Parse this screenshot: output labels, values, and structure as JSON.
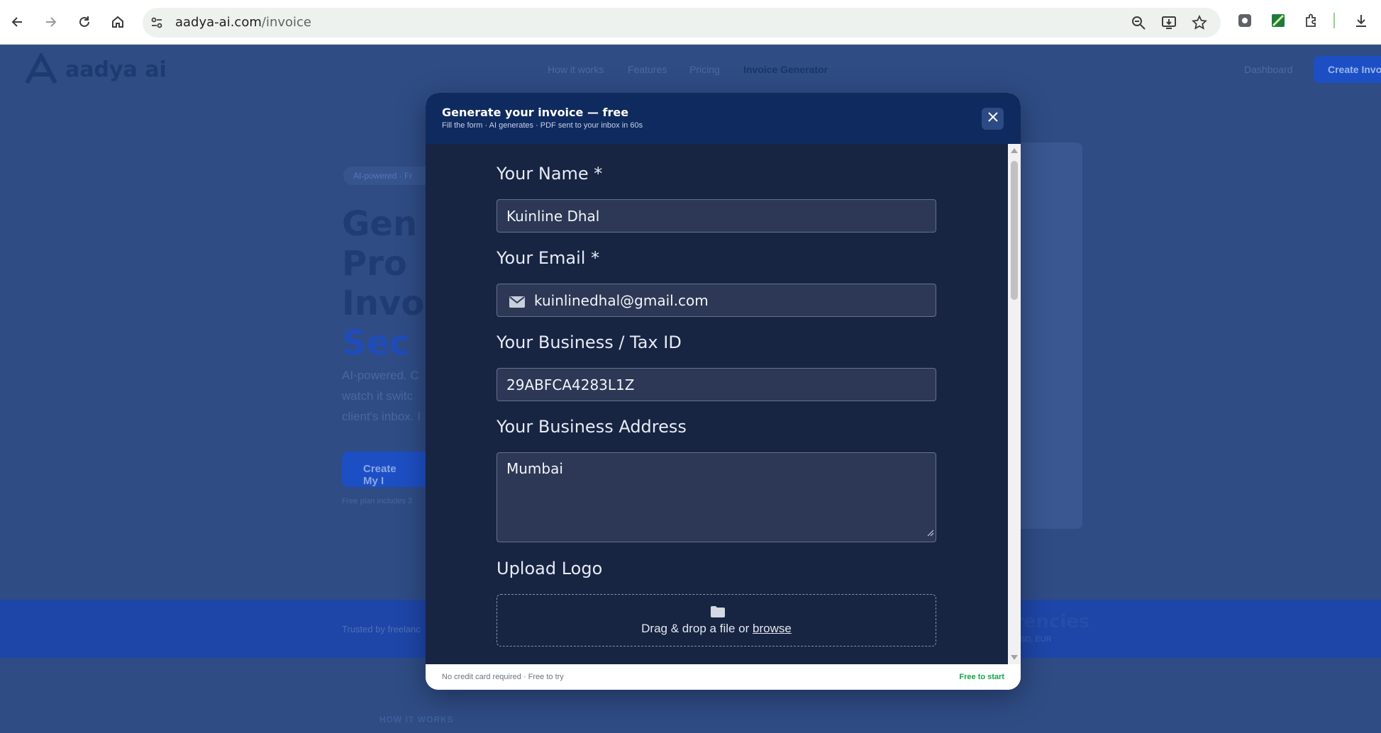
{
  "browser": {
    "url_domain": "aadya-ai.com",
    "url_path": "/invoice"
  },
  "site": {
    "logo_text": "aadya ai",
    "nav": [
      "How it works",
      "Features",
      "Pricing",
      "Invoice Generator"
    ],
    "dashboard_link": "Dashboard",
    "create_button": "Create Invo",
    "hero_pill": "AI-powered · Fr",
    "hero_lines": [
      "Gen",
      "Pro",
      "Invo",
      "Sec"
    ],
    "hero_sub_lines": [
      "AI-powered. C",
      "watch it switc",
      "client's inbox. I"
    ],
    "hero_button": "Create My I",
    "hero_note": "Free plan includes 3",
    "trusted_text": "Trusted by freelanc",
    "currencies_title": "rencies",
    "currencies_sub": "USD, EUR",
    "how_it_works": "HOW IT WORKS"
  },
  "modal": {
    "title": "Generate your invoice — free",
    "subtitle": "Fill the form · AI generates · PDF sent to your inbox in 60s",
    "fields": {
      "name_label": "Your Name *",
      "name_value": "Kuinline Dhal",
      "email_label": "Your Email *",
      "email_value": "kuinlinedhal@gmail.com",
      "taxid_label": "Your Business / Tax ID",
      "taxid_value": "29ABFCA4283L1Z",
      "address_label": "Your Business Address",
      "address_value": "Mumbai",
      "logo_label": "Upload Logo",
      "drop_text": "Drag & drop a file or ",
      "browse_text": "browse"
    },
    "footer_left": "No credit card required · Free to try",
    "footer_right": "Free to start"
  },
  "colors": {
    "modal_header": "#0f2a5e",
    "modal_body": "#172442",
    "input_bg": "#2c3855",
    "accent_green": "#16a34a",
    "brand_blue": "#1d4fc4"
  }
}
